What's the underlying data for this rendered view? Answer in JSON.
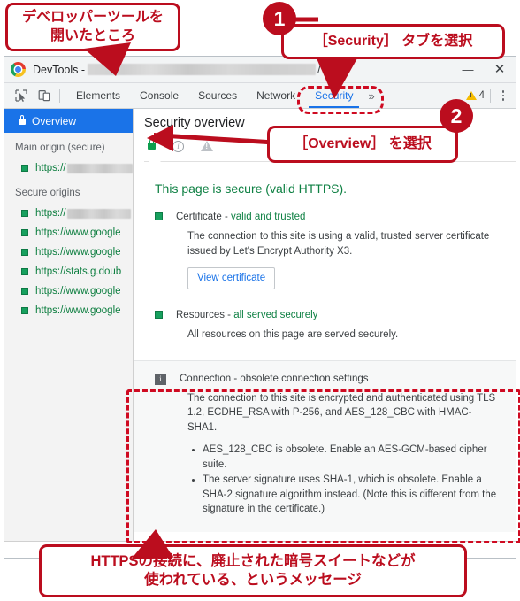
{
  "window": {
    "title_prefix": "DevTools -",
    "title_slash": "/",
    "close_label": "✕",
    "minimize_label": "—"
  },
  "toolbar": {
    "inspect_icon": "inspect-element-icon",
    "device_icon": "device-toolbar-icon",
    "tabs": [
      {
        "label": "Elements",
        "active": false
      },
      {
        "label": "Console",
        "active": false
      },
      {
        "label": "Sources",
        "active": false
      },
      {
        "label": "Network",
        "active": false
      },
      {
        "label": "Security",
        "active": true
      }
    ],
    "more_tabs_label": "»",
    "warning_count": "4",
    "menu_icon": "kebab-menu-icon"
  },
  "sidebar": {
    "overview_label": "Overview",
    "groups": [
      {
        "title": "Main origin (secure)",
        "origins": [
          {
            "scheme": "https://",
            "redacted": true,
            "blur_width": 78
          }
        ]
      },
      {
        "title": "Secure origins",
        "origins": [
          {
            "scheme": "https://",
            "redacted": true,
            "blur_width": 72
          },
          {
            "scheme": "https://www.google",
            "redacted": false
          },
          {
            "scheme": "https://www.google",
            "redacted": false
          },
          {
            "scheme": "https://stats.g.doub",
            "redacted": false
          },
          {
            "scheme": "https://www.google",
            "redacted": false
          },
          {
            "scheme": "https://www.google",
            "redacted": false
          }
        ]
      }
    ]
  },
  "main": {
    "panel_title": "Security overview",
    "status_icons": [
      "lock-icon",
      "info-icon",
      "warning-icon"
    ],
    "headline": "This page is secure (valid HTTPS).",
    "sections": [
      {
        "icon": "green-square-icon",
        "title_main": "Certificate - ",
        "title_status": "valid and trusted",
        "body": "The connection to this site is using a valid, trusted server certificate issued by Let's Encrypt Authority X3.",
        "button": "View certificate"
      },
      {
        "icon": "green-square-icon",
        "title_main": "Resources - ",
        "title_status": "all served securely",
        "body": "All resources on this page are served securely."
      }
    ],
    "connection": {
      "icon": "info-square-icon",
      "title": "Connection - obsolete connection settings",
      "body": "The connection to this site is encrypted and authenticated using TLS 1.2, ECDHE_RSA with P-256, and AES_128_CBC with HMAC-SHA1.",
      "bullets": [
        "AES_128_CBC is obsolete. Enable an AES-GCM-based cipher suite.",
        "The server signature uses SHA-1, which is obsolete. Enable a SHA-2 signature algorithm instead. (Note this is different from the signature in the certificate.)"
      ]
    }
  },
  "annotations": {
    "accent_color": "#bb0d1e",
    "callout_devtools": "デベロッパーツールを\n開いたところ",
    "callout_security": "［Security］ タブを選択",
    "callout_overview": "［Overview］ を選択",
    "callout_bottom": "HTTPSの接続に、廃止された暗号スイートなどが\n使われている、というメッセージ",
    "badge_1": "1",
    "badge_2": "2"
  }
}
